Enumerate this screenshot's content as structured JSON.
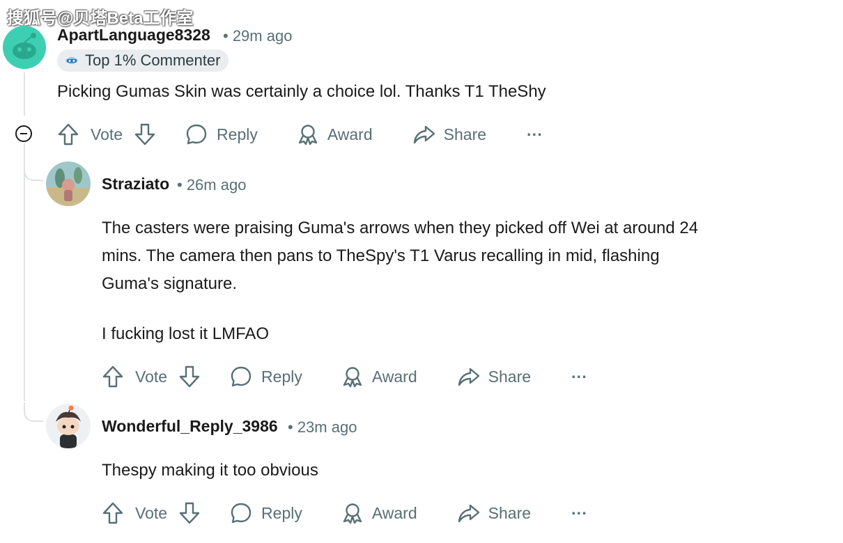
{
  "watermark": "搜狐号@贝塔Beta工作室",
  "labels": {
    "vote": "Vote",
    "reply": "Reply",
    "award": "Award",
    "share": "Share",
    "more": "···"
  },
  "comments": [
    {
      "username": "ApartLanguage8328",
      "time": "• 29m ago",
      "badge": "Top 1% Commenter",
      "body": [
        "Picking Gumas Skin was certainly a choice lol. Thanks T1 TheShy"
      ]
    },
    {
      "username": "Straziato",
      "time": "• 26m ago",
      "body": [
        "The casters were praising Guma's arrows when they picked off Wei at around 24",
        "mins. The camera then pans to TheSpy's T1 Varus recalling in mid, flashing",
        "Guma's signature.",
        "I fucking lost it LMFAO"
      ]
    },
    {
      "username": "Wonderful_Reply_3986",
      "time": "• 23m ago",
      "body": [
        "Thespy making it too obvious"
      ]
    }
  ],
  "colors": {
    "meta": "#576f76",
    "text": "#1a1a1b",
    "thread_line": "#dfe3e6",
    "badge_bg": "#eaedef",
    "avatar1": "#3ecfb2"
  }
}
